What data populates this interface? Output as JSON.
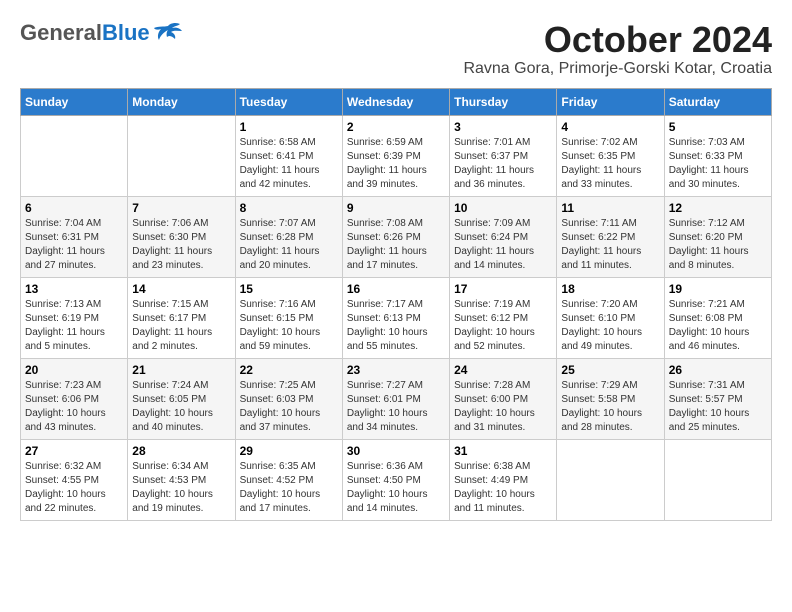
{
  "header": {
    "logo": {
      "general": "General",
      "blue": "Blue"
    },
    "title": "October 2024",
    "location": "Ravna Gora, Primorje-Gorski Kotar, Croatia"
  },
  "calendar": {
    "days_of_week": [
      "Sunday",
      "Monday",
      "Tuesday",
      "Wednesday",
      "Thursday",
      "Friday",
      "Saturday"
    ],
    "weeks": [
      [
        {
          "day": "",
          "sunrise": "",
          "sunset": "",
          "daylight": ""
        },
        {
          "day": "",
          "sunrise": "",
          "sunset": "",
          "daylight": ""
        },
        {
          "day": "1",
          "sunrise": "Sunrise: 6:58 AM",
          "sunset": "Sunset: 6:41 PM",
          "daylight": "Daylight: 11 hours and 42 minutes."
        },
        {
          "day": "2",
          "sunrise": "Sunrise: 6:59 AM",
          "sunset": "Sunset: 6:39 PM",
          "daylight": "Daylight: 11 hours and 39 minutes."
        },
        {
          "day": "3",
          "sunrise": "Sunrise: 7:01 AM",
          "sunset": "Sunset: 6:37 PM",
          "daylight": "Daylight: 11 hours and 36 minutes."
        },
        {
          "day": "4",
          "sunrise": "Sunrise: 7:02 AM",
          "sunset": "Sunset: 6:35 PM",
          "daylight": "Daylight: 11 hours and 33 minutes."
        },
        {
          "day": "5",
          "sunrise": "Sunrise: 7:03 AM",
          "sunset": "Sunset: 6:33 PM",
          "daylight": "Daylight: 11 hours and 30 minutes."
        }
      ],
      [
        {
          "day": "6",
          "sunrise": "Sunrise: 7:04 AM",
          "sunset": "Sunset: 6:31 PM",
          "daylight": "Daylight: 11 hours and 27 minutes."
        },
        {
          "day": "7",
          "sunrise": "Sunrise: 7:06 AM",
          "sunset": "Sunset: 6:30 PM",
          "daylight": "Daylight: 11 hours and 23 minutes."
        },
        {
          "day": "8",
          "sunrise": "Sunrise: 7:07 AM",
          "sunset": "Sunset: 6:28 PM",
          "daylight": "Daylight: 11 hours and 20 minutes."
        },
        {
          "day": "9",
          "sunrise": "Sunrise: 7:08 AM",
          "sunset": "Sunset: 6:26 PM",
          "daylight": "Daylight: 11 hours and 17 minutes."
        },
        {
          "day": "10",
          "sunrise": "Sunrise: 7:09 AM",
          "sunset": "Sunset: 6:24 PM",
          "daylight": "Daylight: 11 hours and 14 minutes."
        },
        {
          "day": "11",
          "sunrise": "Sunrise: 7:11 AM",
          "sunset": "Sunset: 6:22 PM",
          "daylight": "Daylight: 11 hours and 11 minutes."
        },
        {
          "day": "12",
          "sunrise": "Sunrise: 7:12 AM",
          "sunset": "Sunset: 6:20 PM",
          "daylight": "Daylight: 11 hours and 8 minutes."
        }
      ],
      [
        {
          "day": "13",
          "sunrise": "Sunrise: 7:13 AM",
          "sunset": "Sunset: 6:19 PM",
          "daylight": "Daylight: 11 hours and 5 minutes."
        },
        {
          "day": "14",
          "sunrise": "Sunrise: 7:15 AM",
          "sunset": "Sunset: 6:17 PM",
          "daylight": "Daylight: 11 hours and 2 minutes."
        },
        {
          "day": "15",
          "sunrise": "Sunrise: 7:16 AM",
          "sunset": "Sunset: 6:15 PM",
          "daylight": "Daylight: 10 hours and 59 minutes."
        },
        {
          "day": "16",
          "sunrise": "Sunrise: 7:17 AM",
          "sunset": "Sunset: 6:13 PM",
          "daylight": "Daylight: 10 hours and 55 minutes."
        },
        {
          "day": "17",
          "sunrise": "Sunrise: 7:19 AM",
          "sunset": "Sunset: 6:12 PM",
          "daylight": "Daylight: 10 hours and 52 minutes."
        },
        {
          "day": "18",
          "sunrise": "Sunrise: 7:20 AM",
          "sunset": "Sunset: 6:10 PM",
          "daylight": "Daylight: 10 hours and 49 minutes."
        },
        {
          "day": "19",
          "sunrise": "Sunrise: 7:21 AM",
          "sunset": "Sunset: 6:08 PM",
          "daylight": "Daylight: 10 hours and 46 minutes."
        }
      ],
      [
        {
          "day": "20",
          "sunrise": "Sunrise: 7:23 AM",
          "sunset": "Sunset: 6:06 PM",
          "daylight": "Daylight: 10 hours and 43 minutes."
        },
        {
          "day": "21",
          "sunrise": "Sunrise: 7:24 AM",
          "sunset": "Sunset: 6:05 PM",
          "daylight": "Daylight: 10 hours and 40 minutes."
        },
        {
          "day": "22",
          "sunrise": "Sunrise: 7:25 AM",
          "sunset": "Sunset: 6:03 PM",
          "daylight": "Daylight: 10 hours and 37 minutes."
        },
        {
          "day": "23",
          "sunrise": "Sunrise: 7:27 AM",
          "sunset": "Sunset: 6:01 PM",
          "daylight": "Daylight: 10 hours and 34 minutes."
        },
        {
          "day": "24",
          "sunrise": "Sunrise: 7:28 AM",
          "sunset": "Sunset: 6:00 PM",
          "daylight": "Daylight: 10 hours and 31 minutes."
        },
        {
          "day": "25",
          "sunrise": "Sunrise: 7:29 AM",
          "sunset": "Sunset: 5:58 PM",
          "daylight": "Daylight: 10 hours and 28 minutes."
        },
        {
          "day": "26",
          "sunrise": "Sunrise: 7:31 AM",
          "sunset": "Sunset: 5:57 PM",
          "daylight": "Daylight: 10 hours and 25 minutes."
        }
      ],
      [
        {
          "day": "27",
          "sunrise": "Sunrise: 6:32 AM",
          "sunset": "Sunset: 4:55 PM",
          "daylight": "Daylight: 10 hours and 22 minutes."
        },
        {
          "day": "28",
          "sunrise": "Sunrise: 6:34 AM",
          "sunset": "Sunset: 4:53 PM",
          "daylight": "Daylight: 10 hours and 19 minutes."
        },
        {
          "day": "29",
          "sunrise": "Sunrise: 6:35 AM",
          "sunset": "Sunset: 4:52 PM",
          "daylight": "Daylight: 10 hours and 17 minutes."
        },
        {
          "day": "30",
          "sunrise": "Sunrise: 6:36 AM",
          "sunset": "Sunset: 4:50 PM",
          "daylight": "Daylight: 10 hours and 14 minutes."
        },
        {
          "day": "31",
          "sunrise": "Sunrise: 6:38 AM",
          "sunset": "Sunset: 4:49 PM",
          "daylight": "Daylight: 10 hours and 11 minutes."
        },
        {
          "day": "",
          "sunrise": "",
          "sunset": "",
          "daylight": ""
        },
        {
          "day": "",
          "sunrise": "",
          "sunset": "",
          "daylight": ""
        }
      ]
    ]
  }
}
